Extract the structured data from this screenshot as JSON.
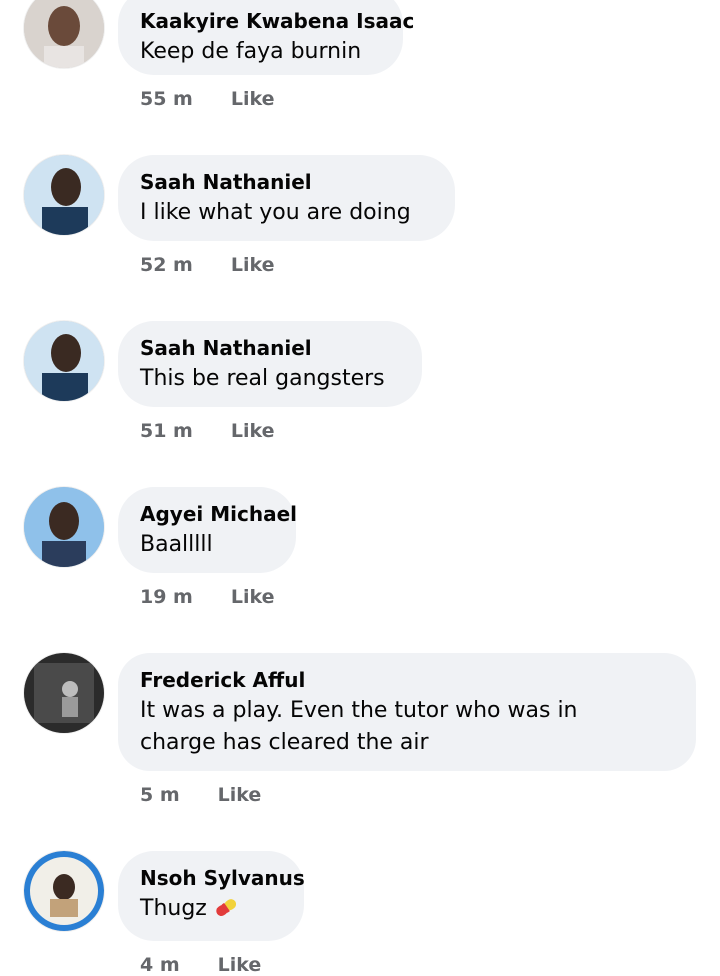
{
  "comments": [
    {
      "name": "Kaakyire Kwabena Isaac",
      "text": "Keep de faya burnin",
      "time": "55 m",
      "like": "Like"
    },
    {
      "name": "Saah Nathaniel",
      "text": "I like what you are doing",
      "time": "52 m",
      "like": "Like"
    },
    {
      "name": "Saah Nathaniel",
      "text": "This be real gangsters",
      "time": "51 m",
      "like": "Like"
    },
    {
      "name": "Agyei Michael",
      "text": "Baalllll",
      "time": "19 m",
      "like": "Like"
    },
    {
      "name": "Frederick Afful",
      "text": "It was a play. Even the tutor who was in charge has cleared the air",
      "time": "5 m",
      "like": "Like"
    },
    {
      "name": "Nsoh Sylvanus",
      "text": "Thugz",
      "time": "4 m",
      "like": "Like",
      "emoji": "pill-icon"
    }
  ],
  "colors": {
    "bubble": "#f0f2f5",
    "meta": "#65676b",
    "text": "#050505"
  }
}
